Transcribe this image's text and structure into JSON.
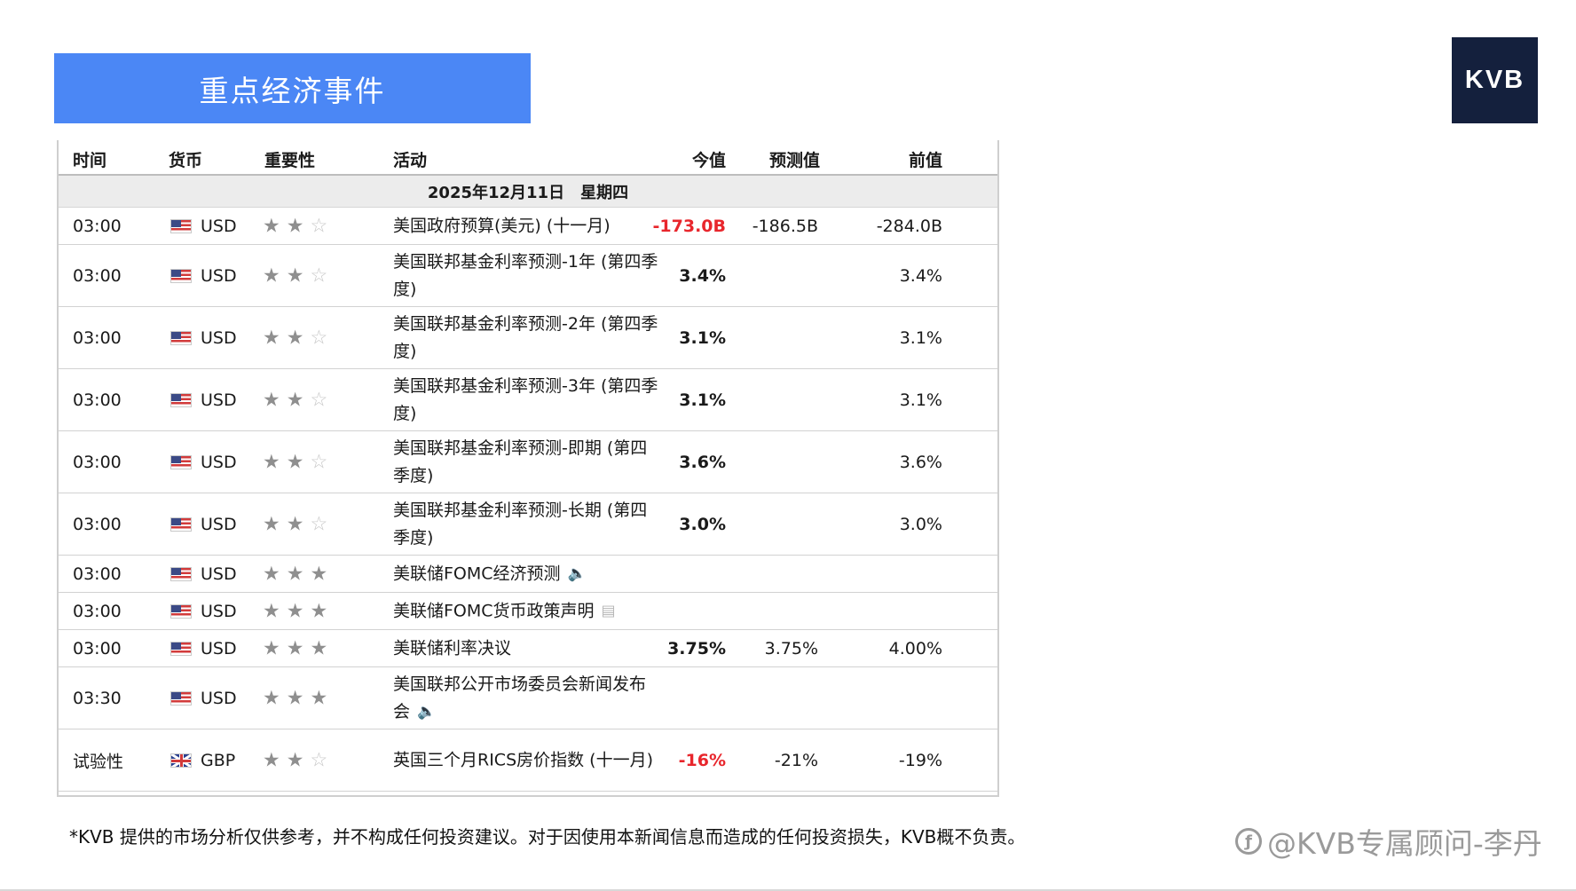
{
  "title": "重点经济事件",
  "logo": "KVB",
  "table": {
    "headers": {
      "time": "时间",
      "currency": "货币",
      "importance": "重要性",
      "event": "活动",
      "actual": "今值",
      "forecast": "预测值",
      "previous": "前值"
    },
    "date": "2025年12月11日　星期四",
    "rows": [
      {
        "time": "03:00",
        "flag": "us-flag-icon",
        "currency": "USD",
        "stars": 2,
        "event": "美国政府预算(美元) (十一月)",
        "icon": "",
        "actual": "-173.0B",
        "actual_color": "#e8262c",
        "forecast": "-186.5B",
        "previous": "-284.0B"
      },
      {
        "time": "03:00",
        "flag": "us-flag-icon",
        "currency": "USD",
        "stars": 2,
        "event": "美国联邦基金利率预测-1年 (第四季度)",
        "icon": "",
        "actual": "3.4%",
        "actual_color": "",
        "forecast": "",
        "previous": "3.4%"
      },
      {
        "time": "03:00",
        "flag": "us-flag-icon",
        "currency": "USD",
        "stars": 2,
        "event": "美国联邦基金利率预测-2年 (第四季度)",
        "icon": "",
        "actual": "3.1%",
        "actual_color": "",
        "forecast": "",
        "previous": "3.1%"
      },
      {
        "time": "03:00",
        "flag": "us-flag-icon",
        "currency": "USD",
        "stars": 2,
        "event": "美国联邦基金利率预测-3年 (第四季度)",
        "icon": "",
        "actual": "3.1%",
        "actual_color": "",
        "forecast": "",
        "previous": "3.1%"
      },
      {
        "time": "03:00",
        "flag": "us-flag-icon",
        "currency": "USD",
        "stars": 2,
        "event": "美国联邦基金利率预测-即期 (第四季度)",
        "icon": "",
        "actual": "3.6%",
        "actual_color": "",
        "forecast": "",
        "previous": "3.6%"
      },
      {
        "time": "03:00",
        "flag": "us-flag-icon",
        "currency": "USD",
        "stars": 2,
        "event": "美国联邦基金利率预测-长期 (第四季度)",
        "icon": "",
        "actual": "3.0%",
        "actual_color": "",
        "forecast": "",
        "previous": "3.0%"
      },
      {
        "time": "03:00",
        "flag": "us-flag-icon",
        "currency": "USD",
        "stars": 3,
        "event": "美联储FOMC经济预测",
        "icon": "speaker-icon",
        "actual": "",
        "actual_color": "",
        "forecast": "",
        "previous": ""
      },
      {
        "time": "03:00",
        "flag": "us-flag-icon",
        "currency": "USD",
        "stars": 3,
        "event": "美联储FOMC货币政策声明",
        "icon": "document-icon",
        "actual": "",
        "actual_color": "",
        "forecast": "",
        "previous": ""
      },
      {
        "time": "03:00",
        "flag": "us-flag-icon",
        "currency": "USD",
        "stars": 3,
        "event": "美联储利率决议",
        "icon": "",
        "actual": "3.75%",
        "actual_color": "",
        "forecast": "3.75%",
        "previous": "4.00%"
      },
      {
        "time": "03:30",
        "flag": "us-flag-icon",
        "currency": "USD",
        "stars": 3,
        "event": "美国联邦公开市场委员会新闻发布会",
        "icon": "speaker-icon",
        "actual": "",
        "actual_color": "",
        "forecast": "",
        "previous": ""
      },
      {
        "time": "试验性",
        "flag": "uk-flag-icon",
        "currency": "GBP",
        "stars": 2,
        "event": "英国三个月RICS房价指数 (十一月)",
        "icon": "",
        "actual": "-16%",
        "actual_color": "#e8262c",
        "forecast": "-21%",
        "previous": "-19%"
      }
    ]
  },
  "disclaimer": "*KVB 提供的市场分析仅供参考，并不构成任何投资建议。对于因使用本新闻信息而造成的任何投资损失，KVB概不负责。",
  "watermark": "@KVB专属顾问-李丹",
  "watermark_icon": "weibo-icon"
}
